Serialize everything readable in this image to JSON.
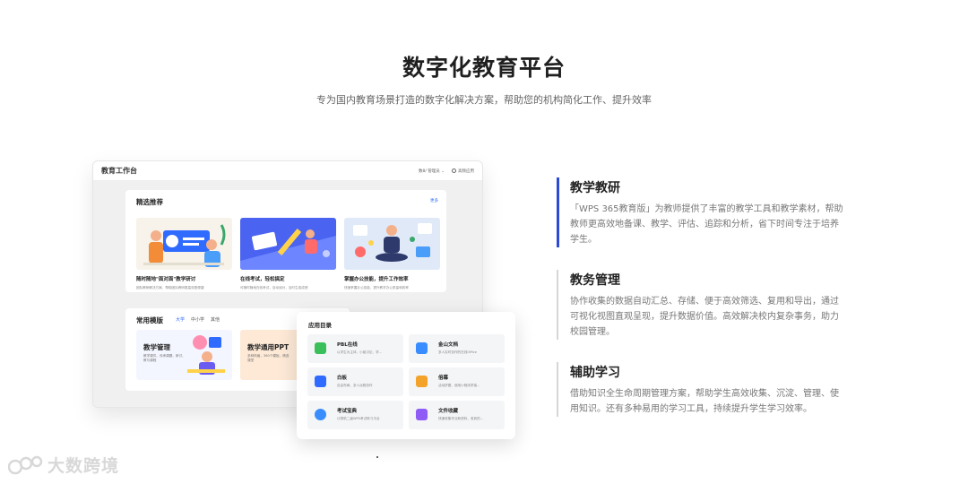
{
  "hero": {
    "title": "数字化教育平台",
    "subtitle": "专为国内教育场景打造的数字化解决方案，帮助您的机构简化工作、提升效率"
  },
  "app": {
    "title": "教育工作台",
    "top_right_user": "数8/ 管理员 ⌄",
    "top_right_link": "高频应用",
    "recommended": {
      "title": "精选推荐",
      "more": "更多",
      "cards": [
        {
          "title": "随时随地\"面对面\"教学研讨",
          "desc": "团队教研解决方案，帮助团队教研更高效更便捷"
        },
        {
          "title": "在线考试，轻松搞定",
          "desc": "可随时随地在线考试，自动阅分，及时生成成绩"
        },
        {
          "title": "掌握办公技能，提升工作效率",
          "desc": "快速掌握办公技能，提升教学办公质量和效率"
        }
      ]
    },
    "templates": {
      "title": "常用模版",
      "tabs": [
        "大学",
        "中小学",
        "其他"
      ],
      "active_tab": "大学",
      "cards": [
        {
          "title": "教学管理",
          "desc": "教学课件、传承课题、研讨、教与课程"
        },
        {
          "title": "教学通用PPT",
          "desc": "多种风格，360个模板，精选课堂"
        }
      ]
    }
  },
  "directory": {
    "title": "应用目录",
    "items": [
      {
        "title": "PBL在线",
        "desc": "以学生为主体，小组讨论、学...",
        "color": "#3bbf5a"
      },
      {
        "title": "金山文档",
        "desc": "多人实时协作的在线Office",
        "color": "#3a8dff"
      },
      {
        "title": "白板",
        "desc": "自由布局、多人远程协作",
        "color": "#2f6bff"
      },
      {
        "title": "倍幕",
        "desc": "活动拼图、使用小程序拼接...",
        "color": "#f4a32a"
      },
      {
        "title": "考试宝典",
        "desc": "计算机二级WPS考试练习平台",
        "color": "#3a8dff"
      },
      {
        "title": "文件收藏",
        "desc": "快速收集作业和资料、收到的...",
        "color": "#8f5cf6"
      }
    ]
  },
  "features": [
    {
      "title": "教学教研",
      "desc": "「WPS 365教育版」为教师提供了丰富的教学工具和教学素材，帮助教师更高效地备课、教学、评估、追踪和分析，省下时间专注于培养学生。",
      "active": true
    },
    {
      "title": "教务管理",
      "desc": "协作收集的数据自动汇总、存储、便于高效筛选、复用和导出，通过可视化视图直观呈现，提升数据价值。高效解决校内复杂事务，助力校园管理。",
      "active": false
    },
    {
      "title": "辅助学习",
      "desc": "借助知识全生命周期管理方案，帮助学生高效收集、沉淀、管理、使用知识。还有多种易用的学习工具，持续提升学生学习效率。",
      "active": false
    }
  ],
  "watermark": "大数跨境",
  "colors": {
    "accent": "#2b4bd4",
    "link": "#2f6bff"
  }
}
